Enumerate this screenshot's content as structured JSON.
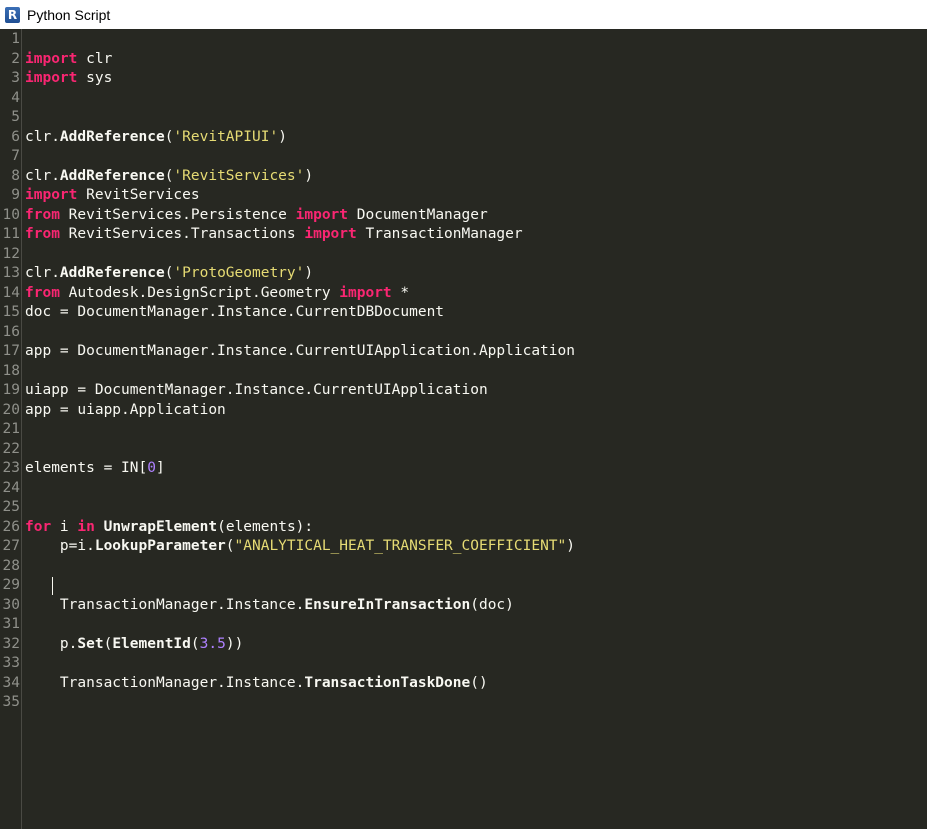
{
  "window": {
    "title": "Python Script",
    "icon_letter": "R"
  },
  "colors": {
    "editor_bg": "#272822",
    "keyword": "#f92672",
    "string": "#e6db74",
    "number": "#ae81ff",
    "text": "#f8f8f2",
    "line_number": "#8f908a"
  },
  "editor": {
    "caret_line": 29,
    "lines": [
      {
        "n": "1",
        "t": []
      },
      {
        "n": "2",
        "t": [
          {
            "c": "kw",
            "v": "import"
          },
          {
            "c": "pl",
            "v": " clr"
          }
        ]
      },
      {
        "n": "3",
        "t": [
          {
            "c": "kw",
            "v": "import"
          },
          {
            "c": "pl",
            "v": " sys"
          }
        ]
      },
      {
        "n": "4",
        "t": []
      },
      {
        "n": "5",
        "t": []
      },
      {
        "n": "6",
        "t": [
          {
            "c": "pl",
            "v": "clr."
          },
          {
            "c": "fn",
            "v": "AddReference"
          },
          {
            "c": "pl",
            "v": "("
          },
          {
            "c": "st",
            "v": "'RevitAPIUI'"
          },
          {
            "c": "pl",
            "v": ")"
          }
        ]
      },
      {
        "n": "7",
        "t": []
      },
      {
        "n": "8",
        "t": [
          {
            "c": "pl",
            "v": "clr."
          },
          {
            "c": "fn",
            "v": "AddReference"
          },
          {
            "c": "pl",
            "v": "("
          },
          {
            "c": "st",
            "v": "'RevitServices'"
          },
          {
            "c": "pl",
            "v": ")"
          }
        ]
      },
      {
        "n": "9",
        "t": [
          {
            "c": "kw",
            "v": "import"
          },
          {
            "c": "pl",
            "v": " RevitServices"
          }
        ]
      },
      {
        "n": "10",
        "t": [
          {
            "c": "kw",
            "v": "from"
          },
          {
            "c": "pl",
            "v": " RevitServices.Persistence "
          },
          {
            "c": "kw",
            "v": "import"
          },
          {
            "c": "pl",
            "v": " DocumentManager"
          }
        ]
      },
      {
        "n": "11",
        "t": [
          {
            "c": "kw",
            "v": "from"
          },
          {
            "c": "pl",
            "v": " RevitServices.Transactions "
          },
          {
            "c": "kw",
            "v": "import"
          },
          {
            "c": "pl",
            "v": " TransactionManager"
          }
        ]
      },
      {
        "n": "12",
        "t": []
      },
      {
        "n": "13",
        "t": [
          {
            "c": "pl",
            "v": "clr."
          },
          {
            "c": "fn",
            "v": "AddReference"
          },
          {
            "c": "pl",
            "v": "("
          },
          {
            "c": "st",
            "v": "'ProtoGeometry'"
          },
          {
            "c": "pl",
            "v": ")"
          }
        ]
      },
      {
        "n": "14",
        "t": [
          {
            "c": "kw",
            "v": "from"
          },
          {
            "c": "pl",
            "v": " Autodesk.DesignScript.Geometry "
          },
          {
            "c": "kw",
            "v": "import"
          },
          {
            "c": "pl",
            "v": " *"
          }
        ]
      },
      {
        "n": "15",
        "t": [
          {
            "c": "pl",
            "v": "doc = DocumentManager.Instance.CurrentDBDocument"
          }
        ]
      },
      {
        "n": "16",
        "t": []
      },
      {
        "n": "17",
        "t": [
          {
            "c": "pl",
            "v": "app = DocumentManager.Instance.CurrentUIApplication.Application"
          }
        ]
      },
      {
        "n": "18",
        "t": []
      },
      {
        "n": "19",
        "t": [
          {
            "c": "pl",
            "v": "uiapp = DocumentManager.Instance.CurrentUIApplication"
          }
        ]
      },
      {
        "n": "20",
        "t": [
          {
            "c": "pl",
            "v": "app = uiapp.Application"
          }
        ]
      },
      {
        "n": "21",
        "t": []
      },
      {
        "n": "22",
        "t": []
      },
      {
        "n": "23",
        "t": [
          {
            "c": "pl",
            "v": "elements = IN["
          },
          {
            "c": "nm",
            "v": "0"
          },
          {
            "c": "pl",
            "v": "]"
          }
        ]
      },
      {
        "n": "24",
        "t": []
      },
      {
        "n": "25",
        "t": []
      },
      {
        "n": "26",
        "t": [
          {
            "c": "kw",
            "v": "for"
          },
          {
            "c": "pl",
            "v": " i "
          },
          {
            "c": "kw",
            "v": "in"
          },
          {
            "c": "pl",
            "v": " "
          },
          {
            "c": "fn",
            "v": "UnwrapElement"
          },
          {
            "c": "pl",
            "v": "(elements):"
          }
        ]
      },
      {
        "n": "27",
        "t": [
          {
            "c": "pl",
            "v": "    p=i."
          },
          {
            "c": "fn",
            "v": "LookupParameter"
          },
          {
            "c": "pl",
            "v": "("
          },
          {
            "c": "st",
            "v": "\"ANALYTICAL_HEAT_TRANSFER_COEFFICIENT\""
          },
          {
            "c": "pl",
            "v": ")"
          }
        ]
      },
      {
        "n": "28",
        "t": []
      },
      {
        "n": "29",
        "t": []
      },
      {
        "n": "30",
        "t": [
          {
            "c": "pl",
            "v": "    TransactionManager.Instance."
          },
          {
            "c": "fn",
            "v": "EnsureInTransaction"
          },
          {
            "c": "pl",
            "v": "(doc)"
          }
        ]
      },
      {
        "n": "31",
        "t": []
      },
      {
        "n": "32",
        "t": [
          {
            "c": "pl",
            "v": "    p."
          },
          {
            "c": "fn",
            "v": "Set"
          },
          {
            "c": "pl",
            "v": "("
          },
          {
            "c": "fn",
            "v": "ElementId"
          },
          {
            "c": "pl",
            "v": "("
          },
          {
            "c": "nm",
            "v": "3.5"
          },
          {
            "c": "pl",
            "v": "))"
          }
        ]
      },
      {
        "n": "33",
        "t": []
      },
      {
        "n": "34",
        "t": [
          {
            "c": "pl",
            "v": "    TransactionManager.Instance."
          },
          {
            "c": "fn",
            "v": "TransactionTaskDone"
          },
          {
            "c": "pl",
            "v": "()"
          }
        ]
      },
      {
        "n": "35",
        "t": []
      }
    ]
  }
}
